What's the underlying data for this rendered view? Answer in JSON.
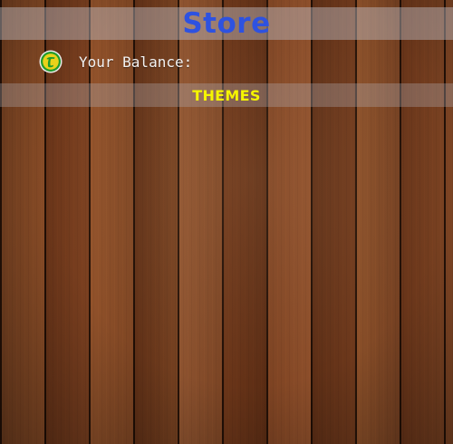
{
  "store": {
    "title": "Store",
    "title_color": "#2e52e0"
  },
  "balance": {
    "label": "Your Balance:",
    "value": "",
    "coin_icon": "coin-icon"
  },
  "section": {
    "label": "THEMES",
    "label_color": "#f5f500"
  },
  "background": {
    "style": "wood-planks"
  }
}
